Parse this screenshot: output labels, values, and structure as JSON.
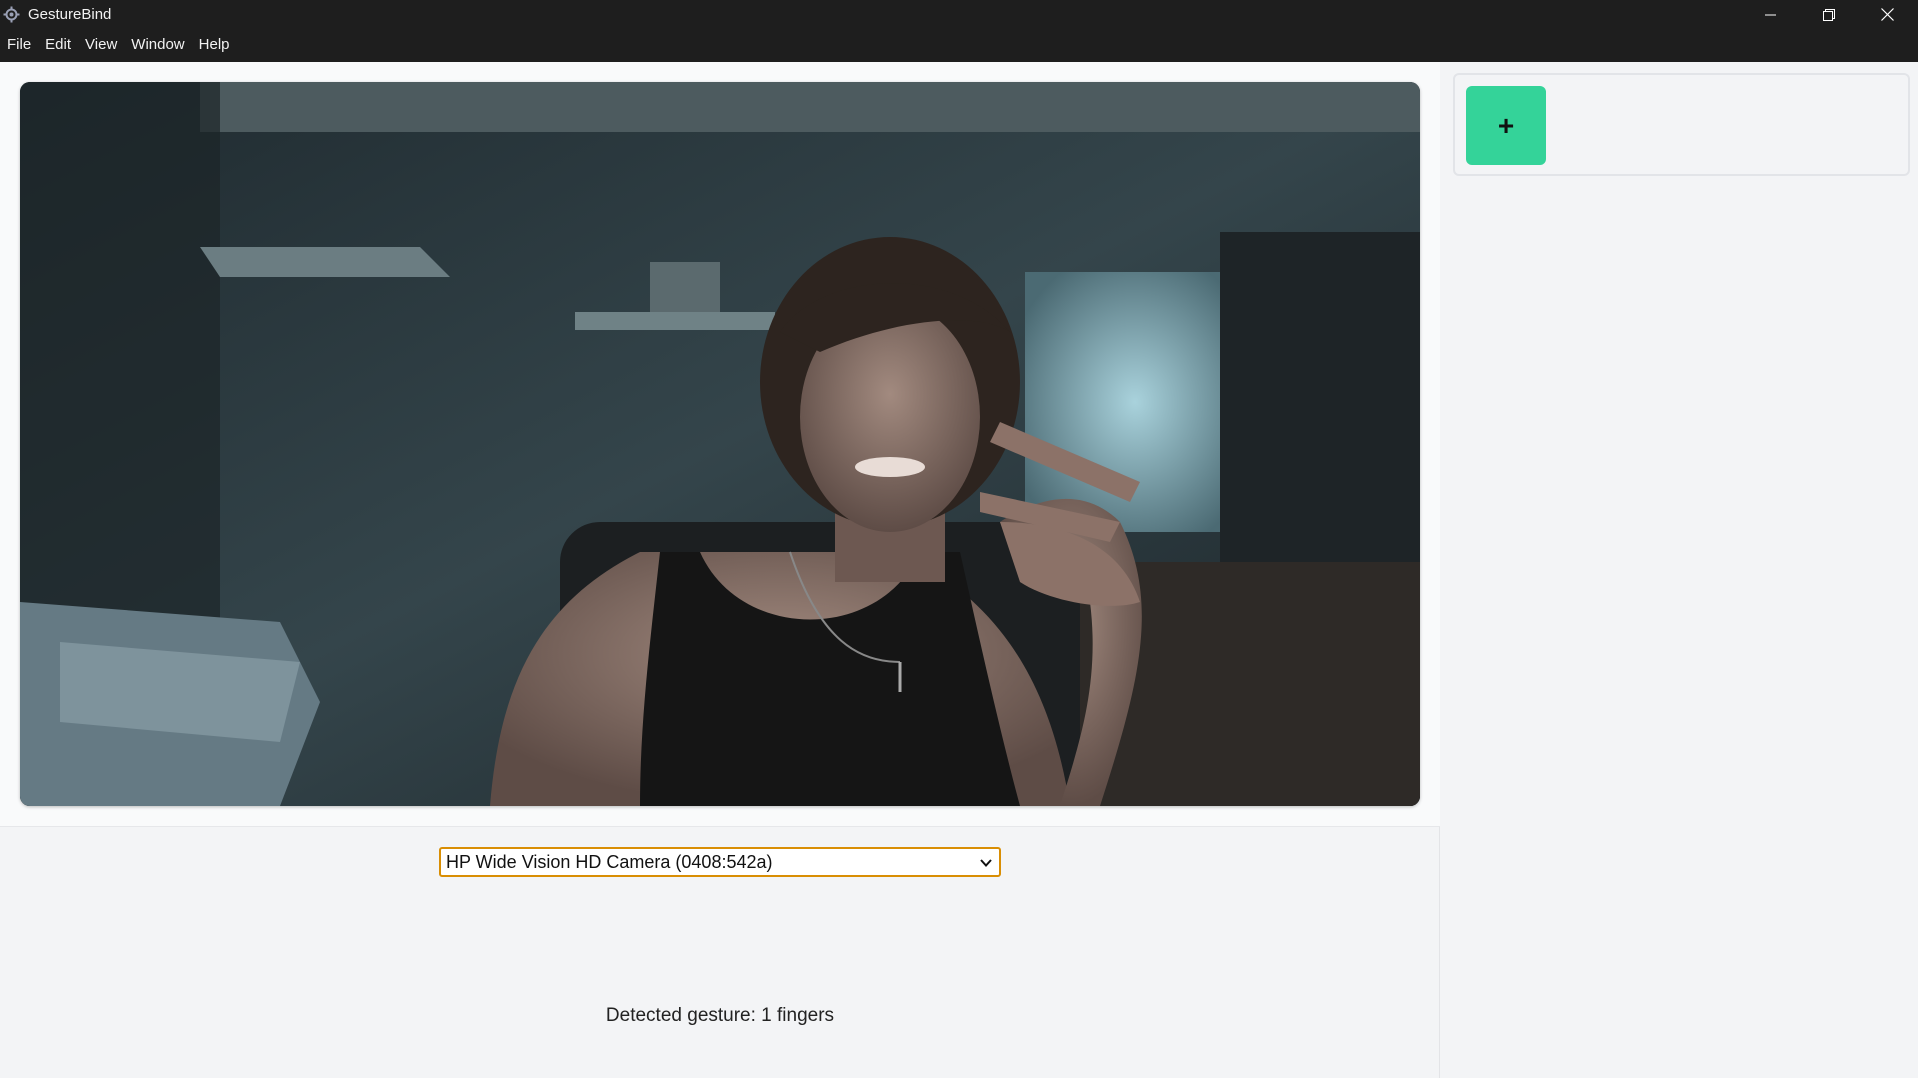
{
  "window": {
    "title": "GestureBind",
    "icon": "gear-app-icon",
    "controls": [
      "minimize-icon",
      "restore-icon",
      "close-icon"
    ]
  },
  "menu": {
    "items": [
      "File",
      "Edit",
      "View",
      "Window",
      "Help"
    ]
  },
  "camera": {
    "selected": "HP Wide Vision HD Camera (0408:542a)"
  },
  "status": {
    "gesture_text": "Detected gesture: 1 fingers"
  },
  "bindings": {
    "add_label": "+"
  },
  "colors": {
    "titlebar": "#1e1e1e",
    "accent_green": "#34d399",
    "select_focus": "#d98e04",
    "background": "#f3f4f6"
  }
}
